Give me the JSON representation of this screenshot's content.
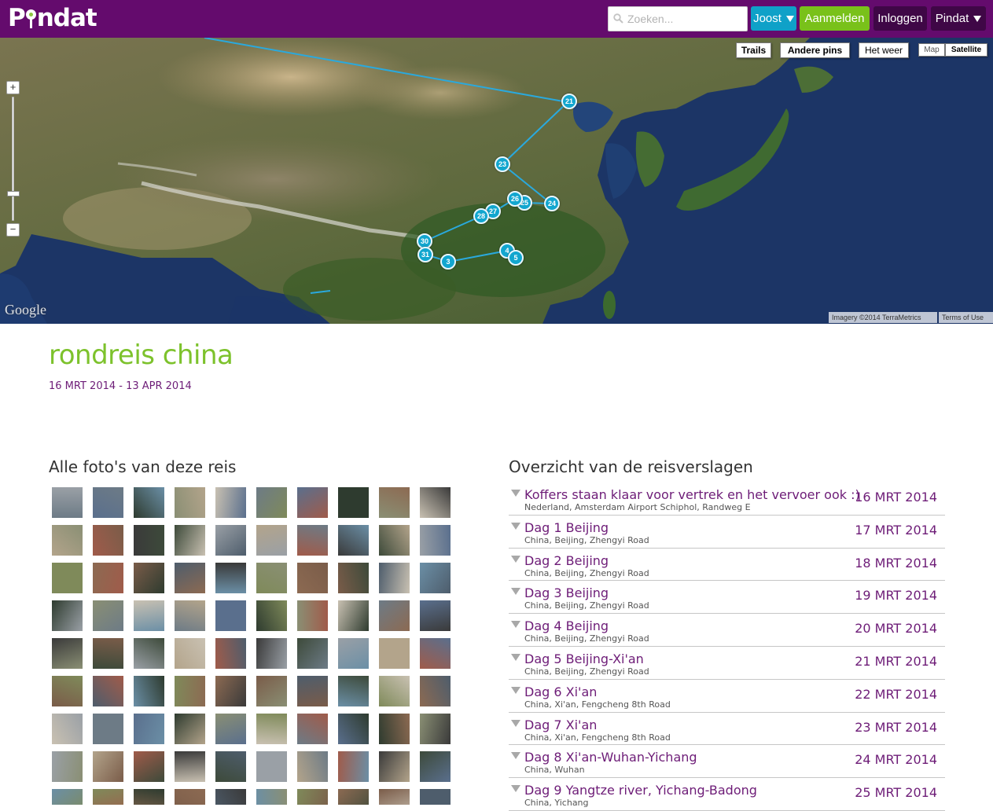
{
  "header": {
    "logo": "Pindat",
    "search_placeholder": "Zoeken...",
    "user_menu": "Joost",
    "register": "Aanmelden",
    "login": "Inloggen",
    "pindat_menu": "Pindat"
  },
  "colors": {
    "header_bg": "#640b6d",
    "accent_green": "#7dc22c",
    "accent_purple": "#6d1c77",
    "marker_blue": "#12a6cf"
  },
  "map": {
    "buttons": {
      "trails": "Trails",
      "other_pins": "Andere pins",
      "weather": "Het weer"
    },
    "type": {
      "map": "Map",
      "satellite": "Satellite",
      "selected": "Satellite"
    },
    "zoom_in": "+",
    "zoom_out": "−",
    "logo": "Google",
    "imagery": "Imagery ©2014 TerraMetrics",
    "terms": "Terms of Use",
    "markers": [
      {
        "label": "21"
      },
      {
        "label": "23"
      },
      {
        "label": "24"
      },
      {
        "label": "25"
      },
      {
        "label": "26"
      },
      {
        "label": "27"
      },
      {
        "label": "28"
      },
      {
        "label": "30"
      },
      {
        "label": "31"
      },
      {
        "label": "3"
      },
      {
        "label": "4"
      },
      {
        "label": "5"
      }
    ]
  },
  "trip": {
    "title": "rondreis china",
    "dates": "16 MRT 2014 - 13 APR 2014"
  },
  "photos": {
    "heading": "Alle foto's van deze reis"
  },
  "stories": {
    "heading": "Overzicht van de reisverslagen",
    "items": [
      {
        "title": "Koffers staan klaar voor vertrek en het vervoer ook :)",
        "location": "Nederland, Amsterdam Airport Schiphol, Randweg E",
        "date": "16 MRT 2014"
      },
      {
        "title": "Dag 1 Beijing",
        "location": "China, Beijing, Zhengyi Road",
        "date": "17 MRT 2014"
      },
      {
        "title": "Dag 2 Beijing",
        "location": "China, Beijing, Zhengyi Road",
        "date": "18 MRT 2014"
      },
      {
        "title": "Dag 3 Beijing",
        "location": "China, Beijing, Zhengyi Road",
        "date": "19 MRT 2014"
      },
      {
        "title": "Dag 4 Beijing",
        "location": "China, Beijing, Zhengyi Road",
        "date": "20 MRT 2014"
      },
      {
        "title": "Dag 5 Beijing-Xi'an",
        "location": "China, Beijing, Zhengyi Road",
        "date": "21 MRT 2014"
      },
      {
        "title": "Dag 6 Xi'an",
        "location": "China, Xi'an, Fengcheng 8th Road",
        "date": "22 MRT 2014"
      },
      {
        "title": "Dag 7 Xi'an",
        "location": "China, Xi'an, Fengcheng 8th Road",
        "date": "23 MRT 2014"
      },
      {
        "title": "Dag 8 Xi'an-Wuhan-Yichang",
        "location": "China, Wuhan",
        "date": "24 MRT 2014"
      },
      {
        "title": "Dag 9 Yangtze river, Yichang-Badong",
        "location": "China, Yichang",
        "date": "25 MRT 2014"
      }
    ]
  }
}
